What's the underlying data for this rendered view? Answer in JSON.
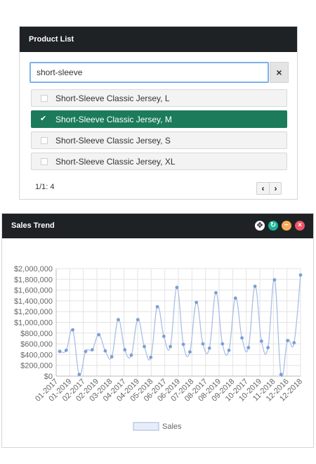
{
  "product_list": {
    "title": "Product List",
    "search_value": "short-sleeve",
    "clear_label": "×",
    "items": [
      {
        "label": "Short-Sleeve Classic Jersey, L",
        "selected": false
      },
      {
        "label": "Short-Sleeve Classic Jersey, M",
        "selected": true
      },
      {
        "label": "Short-Sleeve Classic Jersey, S",
        "selected": false
      },
      {
        "label": "Short-Sleeve Classic Jersey, XL",
        "selected": false
      }
    ],
    "pager_text": "1/1: 4",
    "prev_label": "‹",
    "next_label": "›",
    "selected_color": "#1b7b5b"
  },
  "sales_trend": {
    "title": "Sales Trend",
    "icons": [
      "move-icon",
      "refresh-icon",
      "collapse-icon",
      "close-icon"
    ]
  },
  "chart_data": {
    "type": "line",
    "title": "",
    "xlabel": "",
    "ylabel": "",
    "ylim": [
      0,
      2000000
    ],
    "y_ticks": [
      "$0",
      "$200,000",
      "$400,000",
      "$600,000",
      "$800,000",
      "$1,000,000",
      "$1,200,000",
      "$1,400,000",
      "$1,600,000",
      "$1,800,000",
      "$2,000,000"
    ],
    "x_labels": [
      "01-2017",
      "01-2019",
      "02-2017",
      "02-2019",
      "03-2018",
      "04-2017",
      "04-2019",
      "05-2018",
      "06-2017",
      "06-2019",
      "07-2018",
      "08-2017",
      "08-2019",
      "09-2018",
      "10-2017",
      "10-2019",
      "11-2018",
      "12-2016",
      "12-2018"
    ],
    "grid": true,
    "legend": "bottom",
    "series": [
      {
        "name": "Sales",
        "color": "#7b9ed6",
        "values": [
          460000,
          480000,
          860000,
          30000,
          460000,
          490000,
          770000,
          470000,
          360000,
          1050000,
          490000,
          390000,
          1050000,
          550000,
          350000,
          1290000,
          740000,
          550000,
          1650000,
          590000,
          450000,
          1370000,
          600000,
          520000,
          1550000,
          600000,
          480000,
          1450000,
          710000,
          530000,
          1670000,
          650000,
          530000,
          1790000,
          30000,
          660000,
          620000,
          1880000
        ]
      }
    ]
  }
}
